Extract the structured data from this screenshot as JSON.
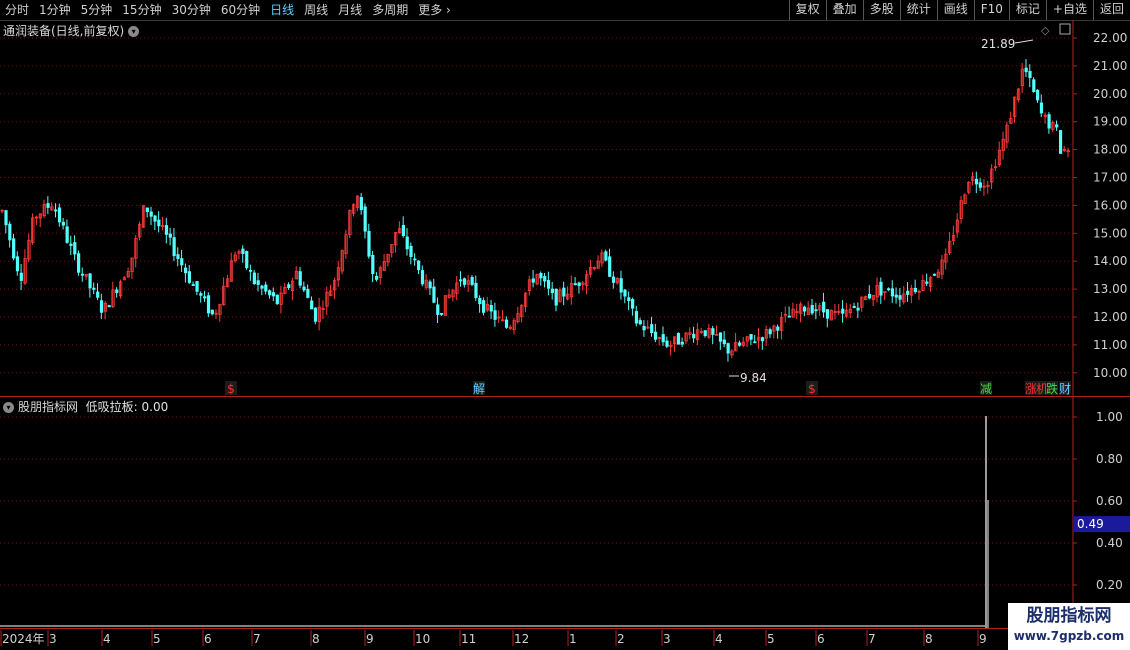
{
  "toolbar": {
    "periods": [
      "分时",
      "1分钟",
      "5分钟",
      "15分钟",
      "30分钟",
      "60分钟",
      "日线",
      "周线",
      "月线",
      "多周期",
      "更多"
    ],
    "active_period": "日线",
    "actions": [
      "复权",
      "叠加",
      "多股",
      "统计",
      "画线",
      "F10",
      "标记",
      "+自选",
      "返回"
    ]
  },
  "main_panel": {
    "title": "通润装备(日线,前复权)",
    "max_label": "21.89",
    "min_label": "9.84",
    "y_ticks": [
      "22.00",
      "21.00",
      "20.00",
      "19.00",
      "18.00",
      "17.00",
      "16.00",
      "15.00",
      "14.00",
      "13.00",
      "12.00",
      "11.00",
      "10.00"
    ],
    "markers": [
      {
        "text": "$",
        "color": "#ff3030"
      },
      {
        "text": "解",
        "color": "#5fd0ff"
      },
      {
        "text": "$",
        "color": "#ff3030"
      },
      {
        "text": "减",
        "color": "#44dd44"
      },
      {
        "text": "涨",
        "color": "#ff3030"
      },
      {
        "text": "机",
        "color": "#e04040"
      },
      {
        "text": "跌",
        "color": "#44dd44"
      },
      {
        "text": "财",
        "color": "#5fd0ff"
      }
    ]
  },
  "sub_panel": {
    "title": "股朋指标网",
    "indicator": "低吸拉板: 0.00",
    "y_ticks": [
      "1.00",
      "0.80",
      "0.60",
      "0.40",
      "0.20"
    ],
    "current_value": "0.49"
  },
  "x_axis": {
    "labels": [
      "2024年",
      "3",
      "4",
      "5",
      "6",
      "7",
      "8",
      "9",
      "10",
      "11",
      "12",
      "1",
      "2",
      "3",
      "4",
      "5",
      "6",
      "7",
      "8",
      "9"
    ]
  },
  "watermark": {
    "line1": "股朋指标网",
    "line2": "www.7gpzb.com"
  },
  "colors": {
    "up": "#ff3b3b",
    "down": "#54ffff",
    "grid": "#7a1010",
    "axis": "#b02020",
    "bg": "#000000"
  },
  "icons": [
    "chevron-down-icon",
    "diamond-icon",
    "layout-toggle-icon",
    "chevron-right-icon"
  ]
}
